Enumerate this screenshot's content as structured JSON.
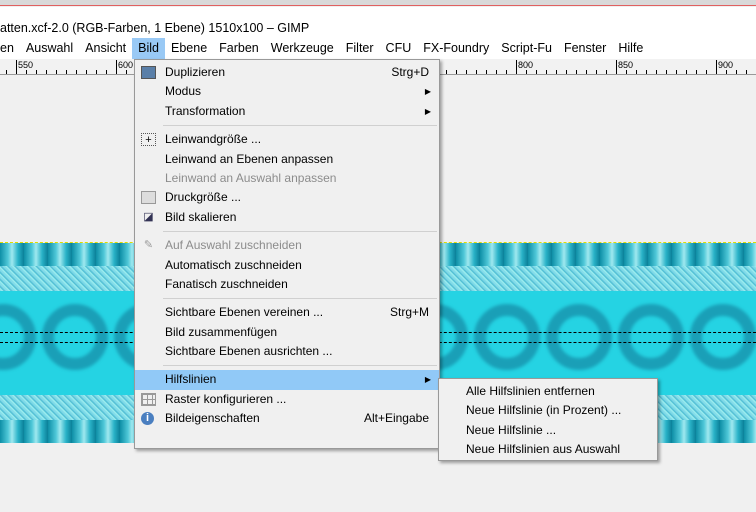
{
  "window": {
    "title": "atten.xcf-2.0 (RGB-Farben, 1 Ebene) 1510x100 – GIMP"
  },
  "menubar": [
    "en",
    "Auswahl",
    "Ansicht",
    "Bild",
    "Ebene",
    "Farben",
    "Werkzeuge",
    "Filter",
    "CFU",
    "FX-Foundry",
    "Script-Fu",
    "Fenster",
    "Hilfe"
  ],
  "ruler": [
    "550",
    "600",
    "800",
    "850",
    "900"
  ],
  "bild_menu": {
    "g1": [
      {
        "label": "Duplizieren",
        "shortcut": "Strg+D",
        "icon": "duplicate-icon"
      },
      {
        "label": "Modus",
        "submenu": true
      },
      {
        "label": "Transformation",
        "submenu": true
      }
    ],
    "g2": [
      {
        "label": "Leinwandgröße ...",
        "icon": "canvas-size-icon"
      },
      {
        "label": "Leinwand an Ebenen anpassen"
      },
      {
        "label": "Leinwand an Auswahl anpassen",
        "disabled": true
      },
      {
        "label": "Druckgröße ...",
        "icon": "print-size-icon"
      },
      {
        "label": "Bild skalieren",
        "icon": "scale-image-icon"
      }
    ],
    "g3": [
      {
        "label": "Auf Auswahl zuschneiden",
        "disabled": true,
        "icon": "crop-icon"
      },
      {
        "label": "Automatisch zuschneiden"
      },
      {
        "label": "Fanatisch zuschneiden"
      }
    ],
    "g4": [
      {
        "label": "Sichtbare Ebenen vereinen ...",
        "shortcut": "Strg+M"
      },
      {
        "label": "Bild zusammenfügen"
      },
      {
        "label": "Sichtbare Ebenen ausrichten ..."
      }
    ],
    "g5": [
      {
        "label": "Hilfslinien",
        "submenu": true
      },
      {
        "label": "Raster konfigurieren ...",
        "icon": "grid-icon"
      },
      {
        "label": "Bildeigenschaften",
        "shortcut": "Alt+Eingabe",
        "icon": "info-icon"
      }
    ]
  },
  "hilfslinien_menu": [
    "Alle Hilfslinien entfernen",
    "Neue Hilfslinie (in Prozent) ...",
    "Neue Hilfslinie ...",
    "Neue Hilfslinien aus Auswahl"
  ]
}
